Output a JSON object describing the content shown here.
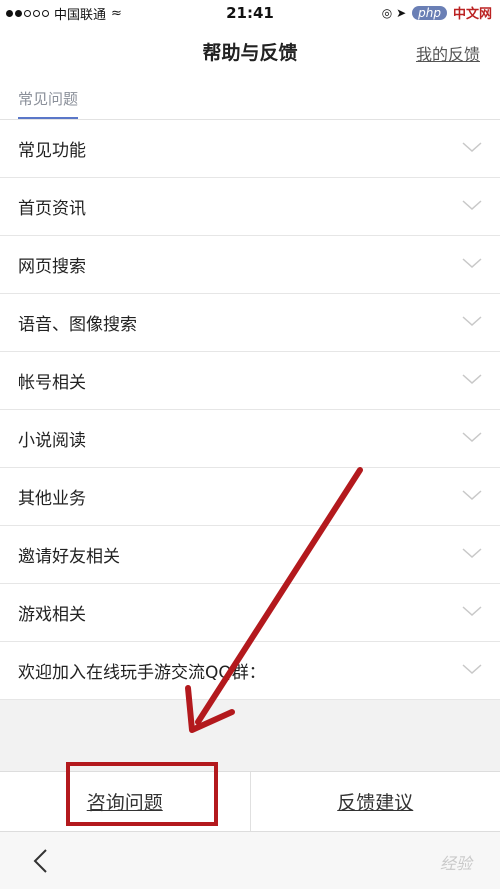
{
  "status_bar": {
    "carrier": "中国联通",
    "wifi": "≈",
    "time": "21:41",
    "right_icons": "◎ ➤",
    "watermark_logo": "php",
    "watermark_text": "中文网"
  },
  "nav": {
    "title": "帮助与反馈",
    "right_link": "我的反馈"
  },
  "section": {
    "tab_label": "常见问题"
  },
  "faq_items": [
    "常见功能",
    "首页资讯",
    "网页搜索",
    "语音、图像搜索",
    "帐号相关",
    "小说阅读",
    "其他业务",
    "邀请好友相关",
    "游戏相关",
    "欢迎加入在线玩手游交流QQ群："
  ],
  "bottom_buttons": {
    "consult": "咨询问题",
    "feedback": "反馈建议"
  },
  "bottom_nav": {
    "watermark": "经验"
  },
  "colors": {
    "accent": "#5a77c8",
    "annotation": "#b3191d"
  },
  "icons": {
    "back": "chevron-left-icon",
    "expand": "chevron-down-icon"
  }
}
